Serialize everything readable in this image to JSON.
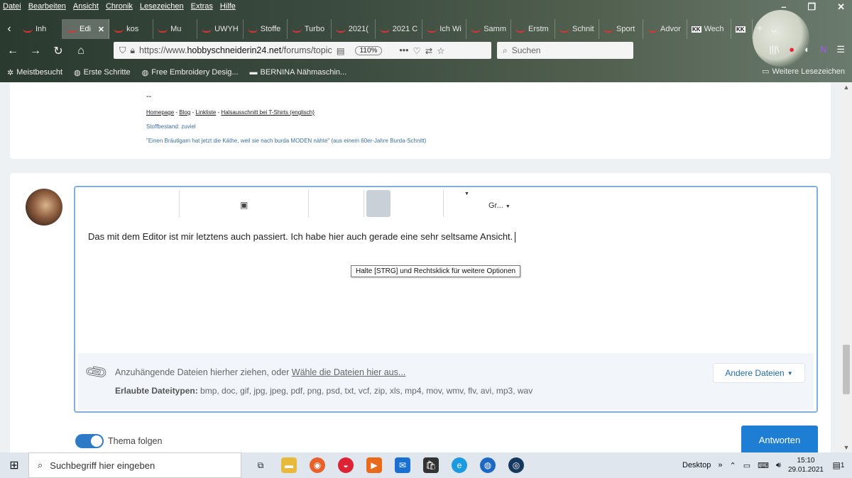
{
  "menubar": [
    "Datei",
    "Bearbeiten",
    "Ansicht",
    "Chronik",
    "Lesezeichen",
    "Extras",
    "Hilfe"
  ],
  "window_buttons": {
    "minimize": "–",
    "restore": "❐",
    "close": "✕"
  },
  "tabs": [
    {
      "label": "Inh"
    },
    {
      "label": "Edi",
      "active": true
    },
    {
      "label": "kos"
    },
    {
      "label": "Mu"
    },
    {
      "label": "UWYH"
    },
    {
      "label": "Stoffe"
    },
    {
      "label": "Turbo"
    },
    {
      "label": "2021("
    },
    {
      "label": "2021 C"
    },
    {
      "label": "Ich Wi"
    },
    {
      "label": "Samm"
    },
    {
      "label": "Erstm"
    },
    {
      "label": "Schnit"
    },
    {
      "label": "Sport"
    },
    {
      "label": "Advor"
    },
    {
      "label": "Wech",
      "kk": true
    },
    {
      "label": "",
      "kk": true
    }
  ],
  "kk_label": "KK",
  "url": {
    "prefix": "https://www.",
    "domain": "hobbyschneiderin24.net",
    "path": "/forums/topic",
    "zoom": "110%"
  },
  "search_placeholder": "Suchen",
  "bookmarks": [
    "Meistbesucht",
    "Erste Schritte",
    "Free Embroidery Desig...",
    "BERNINA Nähmaschin..."
  ],
  "bookmarks_right": "Weitere Lesezeichen",
  "signature": {
    "dashes": "--",
    "links": [
      "Homepage",
      "Blog",
      "Linkliste",
      "Halsausschnitt bei T-Shirts (englisch)"
    ],
    "separator": " - ",
    "stoffbestand": "Stoffbestand: zuviel",
    "quote": "\"Einen Bräutigam hat jetzt die Käthe, weil sie nach burda MODEN nähte\" (aus einem 60er-Jahre Burda-Schnitt)"
  },
  "editor": {
    "toolbar_dropdown": "Gr...",
    "text": "Das mit dem Editor ist mir letztens auch passiert. Ich habe hier auch gerade eine sehr seltsame Ansicht.",
    "tooltip": "Halte [STRG] und Rechtsklick für weitere Optionen"
  },
  "attachments": {
    "drop_text": "Anzuhängende Dateien hierher ziehen, oder ",
    "choose_link": "Wähle die Dateien hier aus...",
    "allowed_label": "Erlaubte Dateitypen:",
    "allowed_types": " bmp, doc, gif, jpg, jpeg, pdf, png, psd, txt, vcf, zip, xls, mp4, mov, wmv, flv, avi, mp3, wav",
    "other_files": "Andere Dateien"
  },
  "follow_toggle": {
    "label": "Thema folgen",
    "on": true
  },
  "reply_button": "Antworten",
  "taskbar": {
    "search_placeholder": "Suchbegriff hier eingeben",
    "desktop": "Desktop",
    "time": "15:10",
    "date": "29.01.2021",
    "notification_count": "1"
  }
}
